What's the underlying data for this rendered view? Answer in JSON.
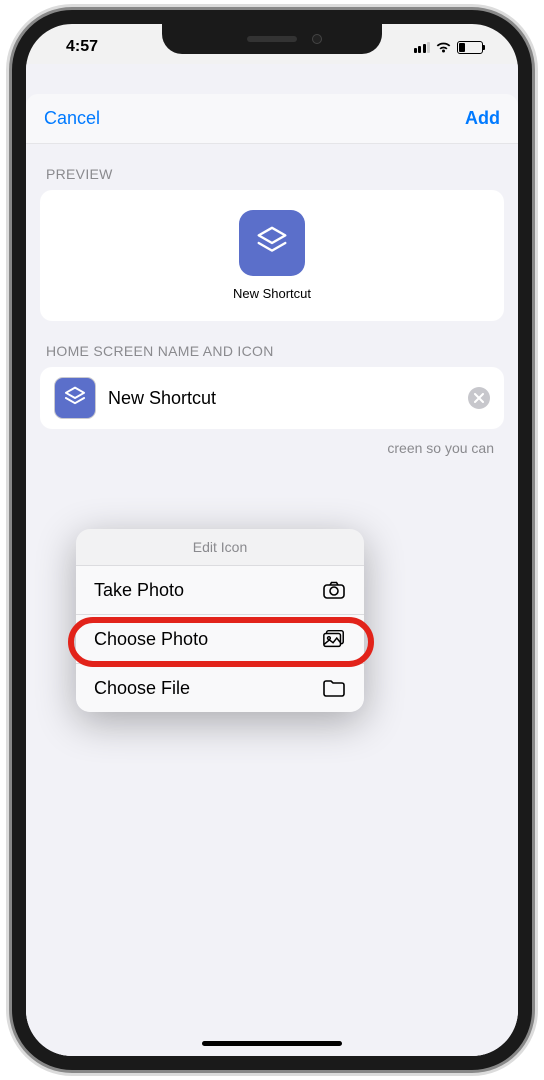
{
  "status": {
    "time": "4:57"
  },
  "nav": {
    "cancel": "Cancel",
    "add": "Add"
  },
  "preview": {
    "header": "PREVIEW",
    "label": "New Shortcut"
  },
  "nameSection": {
    "header": "HOME SCREEN NAME AND ICON",
    "value": "New Shortcut",
    "helper": "creen so you can"
  },
  "popup": {
    "title": "Edit Icon",
    "items": [
      {
        "label": "Take Photo"
      },
      {
        "label": "Choose Photo"
      },
      {
        "label": "Choose File"
      }
    ]
  }
}
